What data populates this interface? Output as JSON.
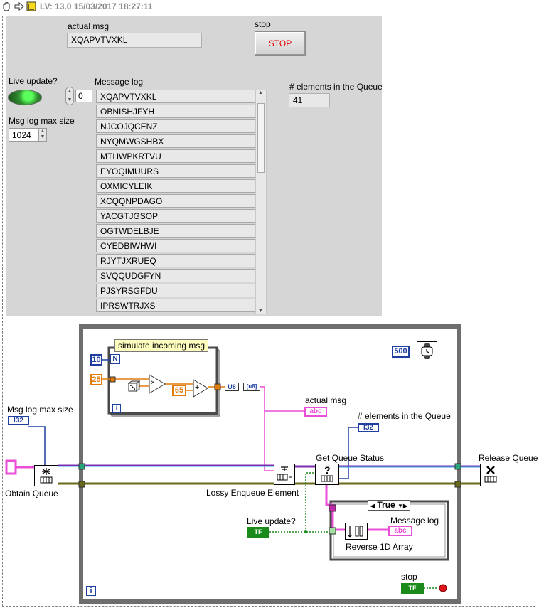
{
  "titlebar": {
    "text": "LV: 13.0 15/03/2017 18:27:11",
    "icons": [
      "hand-icon",
      "run-arrow-icon",
      "labview-icon"
    ]
  },
  "front_panel": {
    "actual_msg": {
      "label": "actual msg",
      "value": "XQAPVTVXKL"
    },
    "stop": {
      "label": "stop",
      "button_text": "STOP"
    },
    "live_update": {
      "label": "Live update?",
      "state": "on"
    },
    "msg_log_max_size": {
      "label": "Msg log max size",
      "value": "1024"
    },
    "array_index": "0",
    "message_log": {
      "label": "Message log",
      "items": [
        "XQAPVTVXKL",
        "OBNISHJFYH",
        "NJCOJQCENZ",
        "NYQMWGSHBX",
        "MTHWPKRTVU",
        "EYOQIMUURS",
        "OXMICYLEIK",
        "XCQQNPDAGO",
        "YACGTJGSOP",
        "OGTWDELBJE",
        "CYEDBIWHWI",
        "RJYTJXRUEQ",
        "SVQQUDGFYN",
        "PJSYRSGFDU",
        "IPRSWTRJXS"
      ]
    },
    "queue_count": {
      "label": "# elements in the Queue",
      "value": "41"
    }
  },
  "block_diagram": {
    "subvi_label": "simulate incoming msg",
    "loop_count_constant": "10",
    "loop_count_terminal": "N",
    "iteration_terminal": "i",
    "random_multiplier": "25",
    "offset_constant": "65",
    "multiply_symbol": "×",
    "add_symbol": "+",
    "u8_label": "U8",
    "byte_array_to_string_label": "[u8]",
    "actual_msg_label": "actual msg",
    "actual_msg_terminal": "abc",
    "queue_count_label": "# elements in the Queue",
    "queue_count_terminal": "I32",
    "msg_log_max_size_label": "Msg log max size",
    "msg_log_max_size_terminal": "I32",
    "obtain_queue_label": "Obtain Queue",
    "lossy_enqueue_label": "Lossy Enqueue Element",
    "get_queue_status_label": "Get Queue Status",
    "release_queue_label": "Release Queue",
    "wait_ms_constant": "500",
    "case_selector": "True",
    "live_update_label": "Live update?",
    "live_update_terminal": "TF",
    "message_log_label": "Message log",
    "message_log_terminal": "abc",
    "reverse_array_label": "Reverse 1D Array",
    "stop_label": "stop",
    "stop_terminal": "TF",
    "while_iteration": "i"
  }
}
